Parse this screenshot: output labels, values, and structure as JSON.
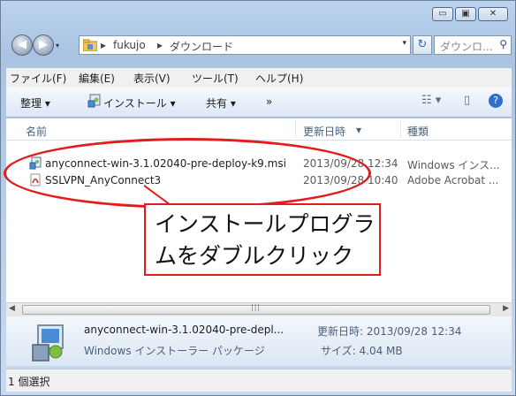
{
  "window": {
    "min": "▭",
    "max": "▣",
    "close": "✕"
  },
  "address": {
    "folder": "fukujo",
    "current": "ダウンロード",
    "search_placeholder": "ダウンロ..."
  },
  "menu": [
    "ファイル(F)",
    "編集(E)",
    "表示(V)",
    "ツール(T)",
    "ヘルプ(H)"
  ],
  "commands": {
    "organize": "整理 ▾",
    "install": "インストール ▾",
    "share": "共有 ▾",
    "more": "»"
  },
  "columns": {
    "name": "名前",
    "date": "更新日時",
    "type": "種類"
  },
  "files": [
    {
      "name": "anyconnect-win-3.1.02040-pre-deploy-k9.msi",
      "date": "2013/09/28 12:34",
      "type": "Windows インス...",
      "icon": "msi-installer-icon"
    },
    {
      "name": "SSLVPN_AnyConnect3",
      "date": "2013/09/28 10:40",
      "type": "Adobe Acrobat ...",
      "icon": "pdf-icon"
    }
  ],
  "details": {
    "filename": "anyconnect-win-3.1.02040-pre-depl...",
    "modified_label": "更新日時: 2013/09/28 12:34",
    "filetype": "Windows インストーラー パッケージ",
    "size_label": "サイズ: 4.04 MB"
  },
  "status": "1 個選択",
  "annotation": {
    "line1": "インストールプログラ",
    "line2": "ムをダブルクリック"
  },
  "colors": {
    "highlight": "#e31b1b",
    "accent": "#2a6ad0"
  }
}
